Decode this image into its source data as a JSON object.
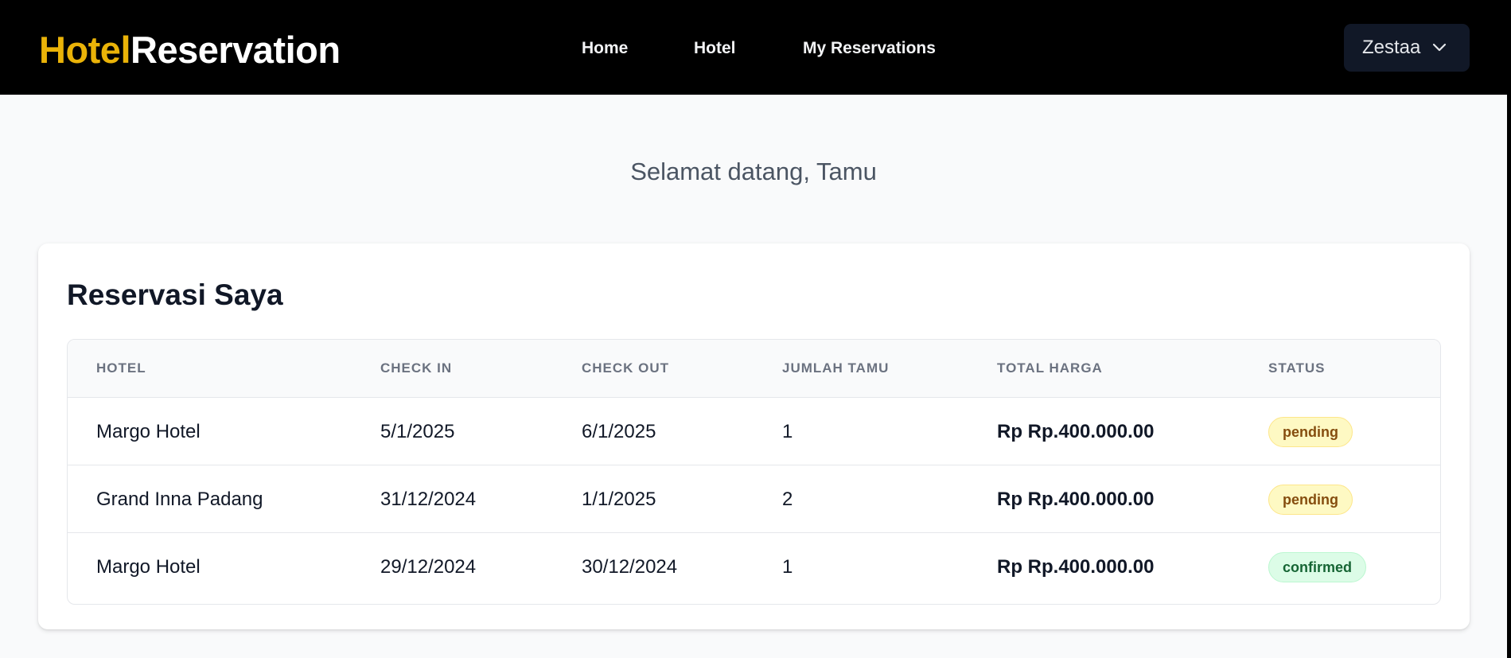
{
  "header": {
    "brand_part1": "Hotel",
    "brand_part2": "Reservation",
    "nav": [
      "Home",
      "Hotel",
      "My Reservations"
    ],
    "user_name": "Zestaa"
  },
  "welcome_text": "Selamat datang, Tamu",
  "reservations": {
    "title": "Reservasi Saya",
    "columns": [
      "HOTEL",
      "CHECK IN",
      "CHECK OUT",
      "JUMLAH TAMU",
      "TOTAL HARGA",
      "STATUS"
    ],
    "rows": [
      {
        "hotel": "Margo Hotel",
        "check_in": "5/1/2025",
        "check_out": "6/1/2025",
        "guests": "1",
        "total": "Rp Rp.400.000.00",
        "status": "pending"
      },
      {
        "hotel": "Grand Inna Padang",
        "check_in": "31/12/2024",
        "check_out": "1/1/2025",
        "guests": "2",
        "total": "Rp Rp.400.000.00",
        "status": "pending"
      },
      {
        "hotel": "Margo Hotel",
        "check_in": "29/12/2024",
        "check_out": "30/12/2024",
        "guests": "1",
        "total": "Rp Rp.400.000.00",
        "status": "confirmed"
      }
    ]
  },
  "colors": {
    "brand_accent": "#eab308",
    "navbar_bg": "#000000",
    "pending_badge": "#fef9c3",
    "confirmed_badge": "#dcfce7"
  },
  "icons": {
    "user_menu": "chevron-down-icon"
  }
}
